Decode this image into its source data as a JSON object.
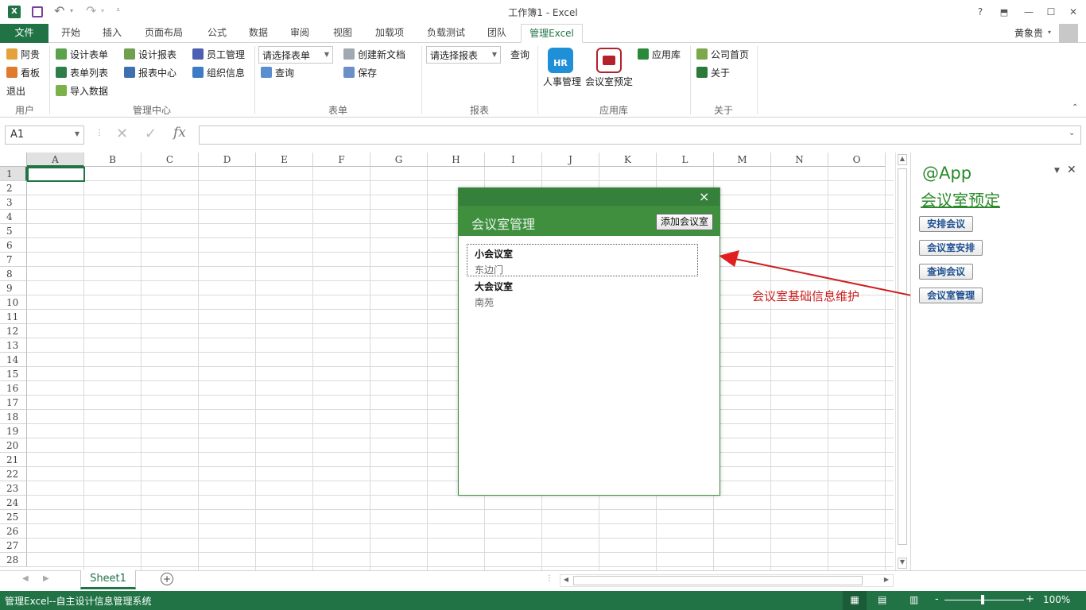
{
  "titlebar": {
    "title": "工作簿1 - Excel",
    "help": "?",
    "user": "黄象贵",
    "minimize": "—",
    "maximize": "☐",
    "close": "✕"
  },
  "tabs": [
    "文件",
    "开始",
    "插入",
    "页面布局",
    "公式",
    "数据",
    "审阅",
    "视图",
    "加载项",
    "负载测试",
    "团队",
    "管理Excel"
  ],
  "ribbon": {
    "user_group": {
      "label": "用户",
      "items": [
        "阿贵",
        "看板",
        "退出"
      ]
    },
    "manage_group": {
      "label": "管理中心",
      "items": [
        "设计表单",
        "表单列表",
        "导入数据",
        "设计报表",
        "报表中心",
        "员工管理",
        "组织信息"
      ]
    },
    "form_group": {
      "label": "表单",
      "combo": "请选择表单",
      "query": "查询",
      "create": "创建新文档",
      "save": "保存"
    },
    "report_group": {
      "label": "报表",
      "combo": "请选择报表",
      "query": "查询"
    },
    "app_group": {
      "label": "应用库",
      "hr": "人事管理",
      "hr_icon_text": "HR",
      "meeting": "会议室预定",
      "store": "应用库"
    },
    "about_group": {
      "label": "关于",
      "home": "公司首页",
      "about": "关于"
    }
  },
  "formula": {
    "namebox": "A1",
    "fx": "fx",
    "value": ""
  },
  "grid": {
    "columns": [
      "A",
      "B",
      "C",
      "D",
      "E",
      "F",
      "G",
      "H",
      "I",
      "J",
      "K",
      "L",
      "M",
      "N",
      "O"
    ],
    "rows": [
      "1",
      "2",
      "3",
      "4",
      "5",
      "6",
      "7",
      "8",
      "9",
      "10",
      "11",
      "12",
      "13",
      "14",
      "15",
      "16",
      "17",
      "18",
      "19",
      "20",
      "21",
      "22",
      "23",
      "24",
      "25",
      "26",
      "27",
      "28"
    ]
  },
  "dialog": {
    "title": "会议室管理",
    "add_button": "添加会议室",
    "close": "×",
    "rooms": [
      {
        "name": "小会议室",
        "location": "东边门"
      },
      {
        "name": "大会议室",
        "location": "南苑"
      }
    ]
  },
  "annotation": "会议室基础信息维护",
  "pane": {
    "app": "@App",
    "title": "会议室预定",
    "buttons": [
      "安排会议",
      "会议室安排",
      "查询会议",
      "会议室管理"
    ]
  },
  "sheets": {
    "active": "Sheet1",
    "add": "+"
  },
  "status": {
    "text": "管理Excel--自主设计信息管理系统",
    "zoom": "100%",
    "minus": "-",
    "plus": "+"
  },
  "colors": {
    "excel_green": "#217346",
    "dialog_green": "#3f8f3f",
    "annotation_red": "#cc1e1e",
    "pane_green": "#2a8a2a"
  }
}
